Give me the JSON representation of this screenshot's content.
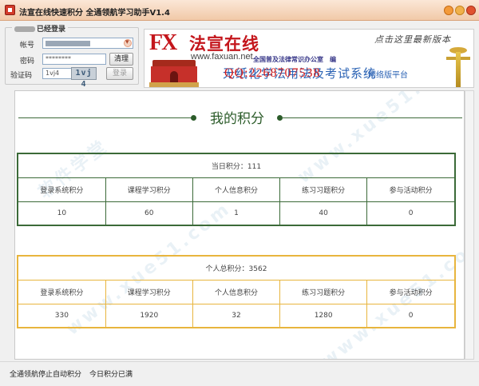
{
  "window": {
    "title": "法宣在线快速积分 全通领航学习助手V1.4"
  },
  "login": {
    "status": "已经登录",
    "account_label": "帐号",
    "password_label": "密码",
    "password_value": "********",
    "captcha_label": "验证码",
    "captcha_value": "1vj4",
    "captcha_image_text": "1vj 4",
    "clear_button": "清理",
    "login_button": "登录"
  },
  "banner": {
    "logo_mark": "FX",
    "logo_cn": "法宣在线",
    "logo_url": "www.faxuan.net",
    "sponsor": "全国普及法律常识办公室　编",
    "slogan": "无纸化学法用法及考试系统",
    "qq": "QQ:2268707538",
    "platform": "网络版平台",
    "update_link": "点击这里最新版本"
  },
  "main": {
    "title": "我的积分",
    "watermark": "www.xue51.com",
    "watermark_cn": "软件学堂",
    "daily": {
      "caption": "当日积分：111",
      "headers": [
        "登录系统积分",
        "课程学习积分",
        "个人信息积分",
        "练习习题积分",
        "参与活动积分"
      ],
      "values": [
        "10",
        "60",
        "1",
        "40",
        "0"
      ]
    },
    "total": {
      "caption": "个人总积分：3562",
      "headers": [
        "登录系统积分",
        "课程学习积分",
        "个人信息积分",
        "练习习题积分",
        "参与活动积分"
      ],
      "values": [
        "330",
        "1920",
        "32",
        "1280",
        "0"
      ]
    }
  },
  "status": {
    "left": "全通领航停止自动积分",
    "right": "今日积分已满"
  },
  "colors": {
    "daily_border": "#3b6a38",
    "total_border": "#e8b53e",
    "title_green": "#2c5c2a"
  }
}
